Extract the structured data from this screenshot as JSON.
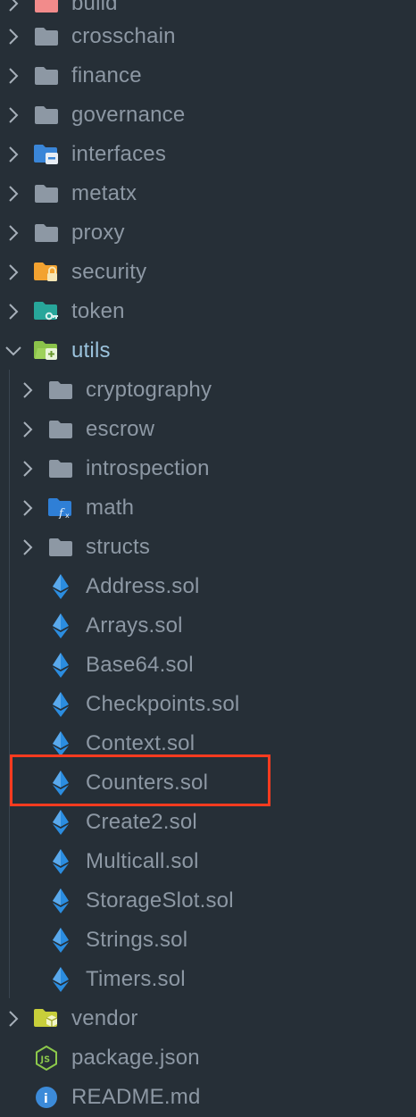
{
  "explorer": {
    "items": [
      {
        "label": "build",
        "icon": "folder-red-icon",
        "kind": "folder",
        "expanded": false
      },
      {
        "label": "crosschain",
        "icon": "folder-icon",
        "kind": "folder",
        "expanded": false
      },
      {
        "label": "finance",
        "icon": "folder-icon",
        "kind": "folder",
        "expanded": false
      },
      {
        "label": "governance",
        "icon": "folder-icon",
        "kind": "folder",
        "expanded": false
      },
      {
        "label": "interfaces",
        "icon": "folder-interfaces-icon",
        "kind": "folder",
        "expanded": false
      },
      {
        "label": "metatx",
        "icon": "folder-icon",
        "kind": "folder",
        "expanded": false
      },
      {
        "label": "proxy",
        "icon": "folder-icon",
        "kind": "folder",
        "expanded": false
      },
      {
        "label": "security",
        "icon": "folder-security-icon",
        "kind": "folder",
        "expanded": false
      },
      {
        "label": "token",
        "icon": "folder-token-icon",
        "kind": "folder",
        "expanded": false
      },
      {
        "label": "utils",
        "icon": "folder-utils-open-icon",
        "kind": "folder",
        "expanded": true
      },
      {
        "label": "cryptography",
        "icon": "folder-icon",
        "kind": "folder",
        "expanded": false
      },
      {
        "label": "escrow",
        "icon": "folder-icon",
        "kind": "folder",
        "expanded": false
      },
      {
        "label": "introspection",
        "icon": "folder-icon",
        "kind": "folder",
        "expanded": false
      },
      {
        "label": "math",
        "icon": "folder-math-icon",
        "kind": "folder",
        "expanded": false
      },
      {
        "label": "structs",
        "icon": "folder-icon",
        "kind": "folder",
        "expanded": false
      },
      {
        "label": "Address.sol",
        "icon": "ethereum-icon",
        "kind": "file"
      },
      {
        "label": "Arrays.sol",
        "icon": "ethereum-icon",
        "kind": "file"
      },
      {
        "label": "Base64.sol",
        "icon": "ethereum-icon",
        "kind": "file"
      },
      {
        "label": "Checkpoints.sol",
        "icon": "ethereum-icon",
        "kind": "file"
      },
      {
        "label": "Context.sol",
        "icon": "ethereum-icon",
        "kind": "file"
      },
      {
        "label": "Counters.sol",
        "icon": "ethereum-icon",
        "kind": "file",
        "highlighted": true
      },
      {
        "label": "Create2.sol",
        "icon": "ethereum-icon",
        "kind": "file"
      },
      {
        "label": "Multicall.sol",
        "icon": "ethereum-icon",
        "kind": "file"
      },
      {
        "label": "StorageSlot.sol",
        "icon": "ethereum-icon",
        "kind": "file"
      },
      {
        "label": "Strings.sol",
        "icon": "ethereum-icon",
        "kind": "file"
      },
      {
        "label": "Timers.sol",
        "icon": "ethereum-icon",
        "kind": "file"
      },
      {
        "label": "vendor",
        "icon": "folder-vendor-icon",
        "kind": "folder",
        "expanded": false
      },
      {
        "label": "package.json",
        "icon": "nodejs-icon",
        "kind": "file"
      },
      {
        "label": "README.md",
        "icon": "info-icon",
        "kind": "file"
      }
    ]
  },
  "colors": {
    "background": "#262f37",
    "text": "#8d98a4",
    "expanded_text": "#9bc3dd",
    "folder": "#8d98a4",
    "ethereum": "#2b8de0",
    "highlight_border": "#ff3b1f"
  }
}
